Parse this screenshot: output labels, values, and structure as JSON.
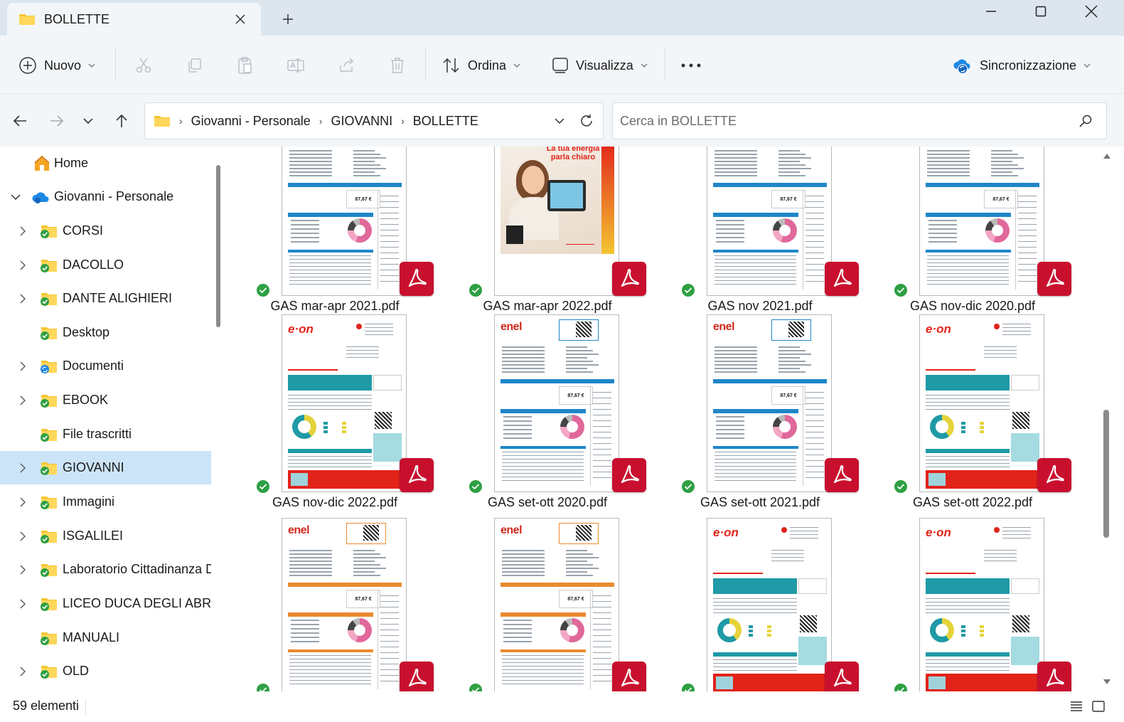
{
  "window": {
    "tab_title": "BOLLETTE"
  },
  "toolbar": {
    "new_label": "Nuovo",
    "sort_label": "Ordina",
    "view_label": "Visualizza",
    "sync_label": "Sincronizzazione"
  },
  "address": {
    "crumbs": [
      "Giovanni - Personale",
      "GIOVANNI",
      "BOLLETTE"
    ],
    "search_placeholder": "Cerca in BOLLETTE"
  },
  "sidebar": {
    "items": [
      {
        "label": "Home",
        "icon": "home-icon"
      },
      {
        "label": "Giovanni - Personale",
        "icon": "cloud-icon"
      },
      {
        "label": "CORSI"
      },
      {
        "label": "DACOLLO"
      },
      {
        "label": "DANTE ALIGHIERI"
      },
      {
        "label": "Desktop"
      },
      {
        "label": "Documenti"
      },
      {
        "label": "EBOOK"
      },
      {
        "label": "File trascritti"
      },
      {
        "label": "GIOVANNI"
      },
      {
        "label": "Immagini"
      },
      {
        "label": "ISGALILEI"
      },
      {
        "label": "Laboratorio Cittadinanza D"
      },
      {
        "label": "LICEO DUCA DEGLI ABRUZ"
      },
      {
        "label": "MANUALI"
      },
      {
        "label": "OLD"
      }
    ]
  },
  "files": [
    {
      "name": "GAS mar-apr 2021.pdf",
      "provider": "enel"
    },
    {
      "name": "GAS mar-apr 2022.pdf",
      "provider": "eon-ad",
      "ad_text": "La tua energia parla chiaro"
    },
    {
      "name": "GAS nov 2021.pdf",
      "provider": "enel"
    },
    {
      "name": "GAS nov-dic 2020.pdf",
      "provider": "enel"
    },
    {
      "name": "GAS nov-dic 2022.pdf",
      "provider": "eon",
      "logo": "e·on"
    },
    {
      "name": "GAS set-ott 2020.pdf",
      "provider": "enel",
      "logo": "enel"
    },
    {
      "name": "GAS set-ott 2021.pdf",
      "provider": "enel",
      "logo": "enel"
    },
    {
      "name": "GAS set-ott 2022.pdf",
      "provider": "eon",
      "logo": "e·on"
    },
    {
      "name": "",
      "provider": "enel-orange",
      "logo": "enel"
    },
    {
      "name": "",
      "provider": "enel-orange",
      "logo": "enel"
    },
    {
      "name": "",
      "provider": "eon",
      "logo": "e·on"
    },
    {
      "name": "",
      "provider": "eon",
      "logo": "e·on"
    }
  ],
  "status": {
    "count": "59 elementi"
  },
  "colors": {
    "selected": "#cce4f7",
    "pdf_red": "#c8102e",
    "sync_green": "#2ea043",
    "folder_yellow": "#f4c531"
  }
}
